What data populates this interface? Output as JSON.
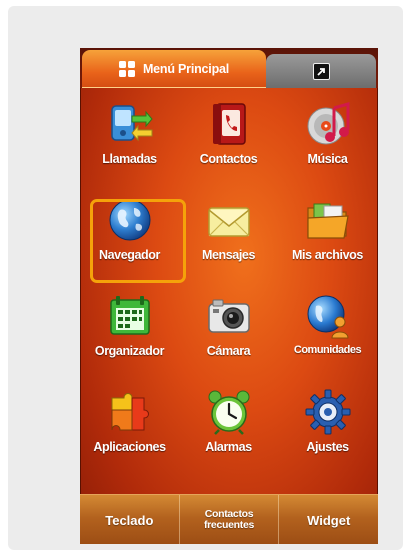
{
  "tabs": {
    "main_label": "Menú Principal",
    "main_icon": "grid-icon",
    "widget_icon": "shortcut-icon"
  },
  "apps": [
    {
      "label": "Llamadas",
      "icon": "phone-call-icon"
    },
    {
      "label": "Contactos",
      "icon": "contacts-book-icon"
    },
    {
      "label": "Música",
      "icon": "music-icon"
    },
    {
      "label": "Navegador",
      "icon": "globe-icon"
    },
    {
      "label": "Mensajes",
      "icon": "envelope-icon"
    },
    {
      "label": "Mis archivos",
      "icon": "folder-icon"
    },
    {
      "label": "Organizador",
      "icon": "calendar-icon"
    },
    {
      "label": "Cámara",
      "icon": "camera-icon"
    },
    {
      "label": "Comunidades",
      "icon": "community-globe-icon"
    },
    {
      "label": "Aplicaciones",
      "icon": "puzzle-icon"
    },
    {
      "label": "Alarmas",
      "icon": "alarm-clock-icon"
    },
    {
      "label": "Ajustes",
      "icon": "gear-icon"
    }
  ],
  "highlighted_app": "Navegador",
  "bottom_bar": {
    "keypad": "Teclado",
    "frequent_line1": "Contactos",
    "frequent_line2": "frecuentes",
    "widget": "Widget"
  },
  "colors": {
    "highlight": "#f5a20a",
    "background": "#dc4a12"
  }
}
